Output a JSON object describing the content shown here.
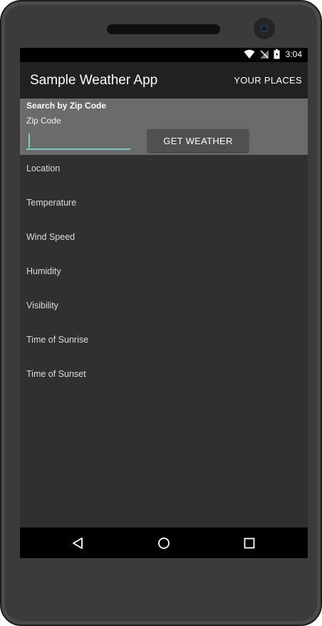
{
  "status_bar": {
    "time": "3:04",
    "icons": [
      "wifi-icon",
      "no-signal-icon",
      "battery-icon"
    ]
  },
  "app_bar": {
    "title": "Sample Weather App",
    "action": "YOUR PLACES"
  },
  "search": {
    "heading": "Search by Zip Code",
    "zip_label": "Zip Code",
    "zip_value": "",
    "button_label": "GET WEATHER"
  },
  "fields": [
    {
      "label": "Location"
    },
    {
      "label": "Temperature"
    },
    {
      "label": "Wind Speed"
    },
    {
      "label": "Humidity"
    },
    {
      "label": "Visibility"
    },
    {
      "label": "Time of Sunrise"
    },
    {
      "label": "Time of Sunset"
    }
  ],
  "nav_bar": {
    "icons": [
      "back-icon",
      "home-icon",
      "recents-icon"
    ]
  },
  "colors": {
    "accent": "#80cbc4",
    "app_bar": "#212121",
    "search_panel": "#6b6b6b",
    "background": "#303030"
  }
}
